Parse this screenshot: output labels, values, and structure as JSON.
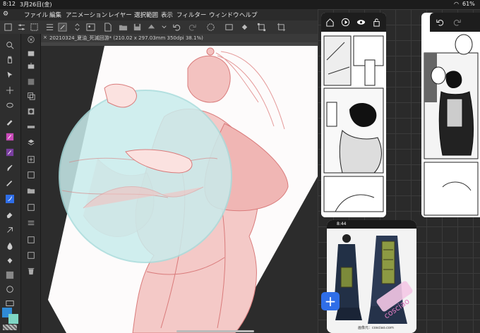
{
  "status": {
    "time": "8:12",
    "date": "3月26日(金)",
    "battery": "61%"
  },
  "menu": [
    "ファイル",
    "編集",
    "アニメーション",
    "レイヤー",
    "選択範囲",
    "表示",
    "フィルター",
    "ウィンドウ",
    "ヘルプ"
  ],
  "document": {
    "tab_title": "20210324_夏油_死滅回游* (210.02 x 297.03mm 350dpi 38.1%)"
  },
  "photo_panel": {
    "time": "8:44",
    "source_caption": "画像元：cosciao.com"
  },
  "add_button_label": "+",
  "colors": {
    "main_color": "#2f8bd6",
    "sub_color": "#7fd6c4",
    "accent": "#2f6ee8"
  }
}
